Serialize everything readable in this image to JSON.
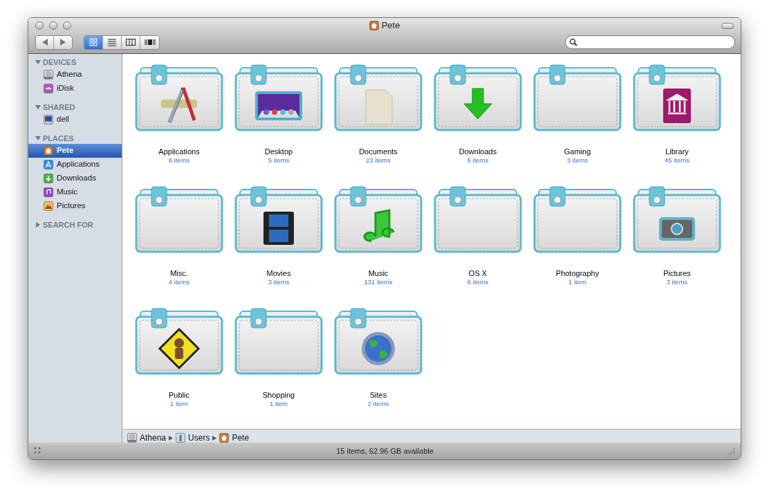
{
  "window": {
    "title": "Pete"
  },
  "toolbar": {
    "views": [
      {
        "kind": "icons",
        "selected": true
      },
      {
        "kind": "list",
        "selected": false
      },
      {
        "kind": "columns",
        "selected": false
      },
      {
        "kind": "coverflow",
        "selected": false
      }
    ]
  },
  "sidebar": {
    "sections": [
      {
        "title": "DEVICES",
        "expanded": true,
        "items": [
          {
            "label": "Athena",
            "kind": "drive",
            "selected": false
          },
          {
            "label": "iDisk",
            "kind": "idisk",
            "selected": false
          }
        ]
      },
      {
        "title": "SHARED",
        "expanded": true,
        "items": [
          {
            "label": "dell",
            "kind": "monitor",
            "selected": false
          }
        ]
      },
      {
        "title": "PLACES",
        "expanded": true,
        "items": [
          {
            "label": "Pete",
            "kind": "home",
            "selected": true
          },
          {
            "label": "Applications",
            "kind": "apps",
            "selected": false
          },
          {
            "label": "Downloads",
            "kind": "downloads",
            "selected": false
          },
          {
            "label": "Music",
            "kind": "music",
            "selected": false
          },
          {
            "label": "Pictures",
            "kind": "pictures",
            "selected": false
          }
        ]
      },
      {
        "title": "SEARCH FOR",
        "expanded": false
      }
    ]
  },
  "folders": [
    {
      "name": "Applications",
      "count": "8 items",
      "kind": "apps"
    },
    {
      "name": "Desktop",
      "count": "5 items",
      "kind": "desktop"
    },
    {
      "name": "Documents",
      "count": "23 items",
      "kind": "document"
    },
    {
      "name": "Downloads",
      "count": "6 items",
      "kind": "download"
    },
    {
      "name": "Gaming",
      "count": "3 items",
      "kind": "plain"
    },
    {
      "name": "Library",
      "count": "45 items",
      "kind": "library"
    },
    {
      "name": "Misc.",
      "count": "4 items",
      "kind": "plain"
    },
    {
      "name": "Movies",
      "count": "3 items",
      "kind": "movies"
    },
    {
      "name": "Music",
      "count": "131 items",
      "kind": "music"
    },
    {
      "name": "OS X",
      "count": "6 items",
      "kind": "plain"
    },
    {
      "name": "Photography",
      "count": "1 item",
      "kind": "plain"
    },
    {
      "name": "Pictures",
      "count": "3 items",
      "kind": "camera"
    },
    {
      "name": "Public",
      "count": "1 item",
      "kind": "public"
    },
    {
      "name": "Shopping",
      "count": "1 item",
      "kind": "plain"
    },
    {
      "name": "Sites",
      "count": "2 items",
      "kind": "globe"
    }
  ],
  "path_bar": [
    {
      "label": "Athena",
      "kind": "drive"
    },
    {
      "label": "Users",
      "kind": "users"
    },
    {
      "label": "Pete",
      "kind": "home"
    }
  ],
  "status_bar": "15 items, 62.96 GB available"
}
